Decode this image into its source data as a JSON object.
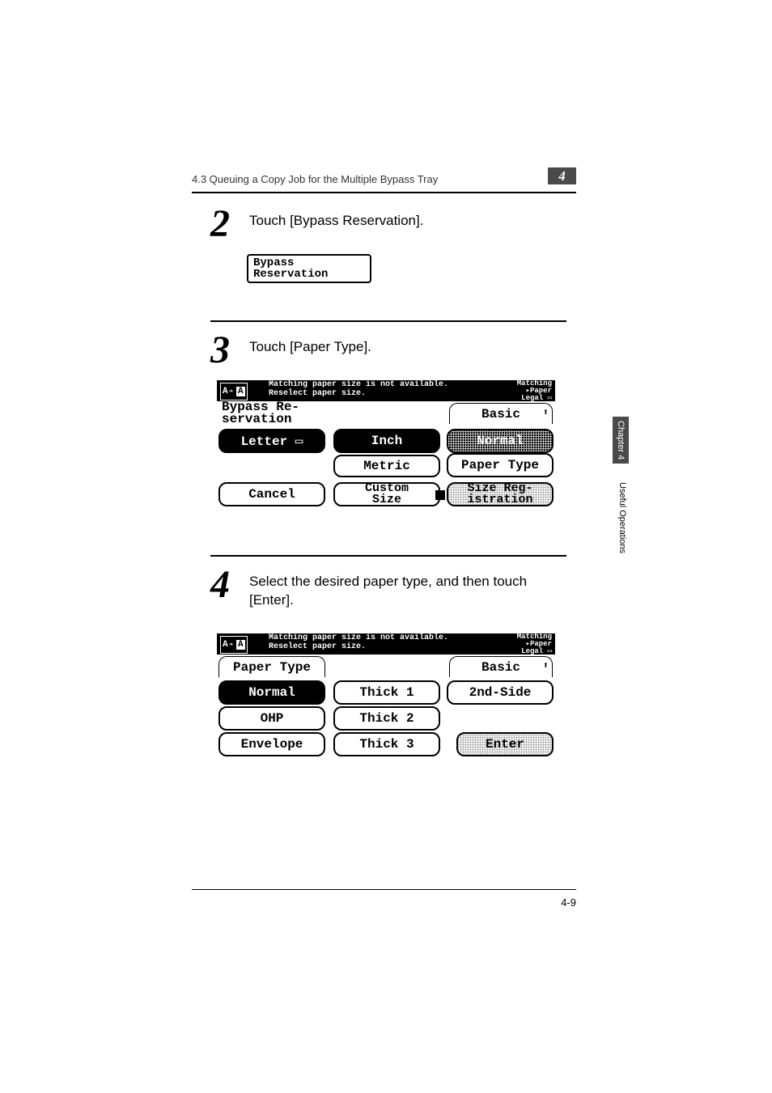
{
  "header": {
    "section_title": "4.3 Queuing a Copy Job for the Multiple Bypass Tray",
    "chapter_chip": "4"
  },
  "side": {
    "chapter": "Chapter 4",
    "label": "Useful Operations"
  },
  "steps": {
    "s2": {
      "num": "2",
      "text": "Touch [Bypass Reservation]."
    },
    "s3": {
      "num": "3",
      "text": "Touch [Paper Type]."
    },
    "s4": {
      "num": "4",
      "text": "Select the desired paper type, and then touch [Enter]."
    }
  },
  "bypass_btn": {
    "line1": "Bypass",
    "line2": "Reservation"
  },
  "lcd_a": {
    "icon_left": "A",
    "icon_arrow": "➔",
    "icon_right": "A",
    "msg1": "Matching paper size is not available.",
    "msg2": "Reselect paper size.",
    "right1": "Matching",
    "right2": "▸Paper",
    "right3": "Legal ▭",
    "title1": "Bypass Re-",
    "title2": "servation",
    "basic": "Basic",
    "letter": "Letter ▭",
    "inch": "Inch",
    "metric": "Metric",
    "normal": "Normal",
    "paper_type": "Paper Type",
    "cancel": "Cancel",
    "custom1": "Custom",
    "custom2": "Size",
    "sizereg1": "Size Reg-",
    "sizereg2": "istration"
  },
  "lcd_b": {
    "icon_left": "A",
    "icon_arrow": "➔",
    "icon_right": "A",
    "msg1": "Matching paper size is not available.",
    "msg2": "Reselect paper size.",
    "right1": "Matching",
    "right2": "▸Paper",
    "right3": "Legal ▭",
    "title": "Paper Type",
    "basic": "Basic",
    "normal": "Normal",
    "ohp": "OHP",
    "envelope": "Envelope",
    "thick1": "Thick 1",
    "thick2": "Thick 2",
    "thick3": "Thick 3",
    "second": "2nd-Side",
    "enter": "Enter"
  },
  "footer": {
    "page": "4-9"
  }
}
